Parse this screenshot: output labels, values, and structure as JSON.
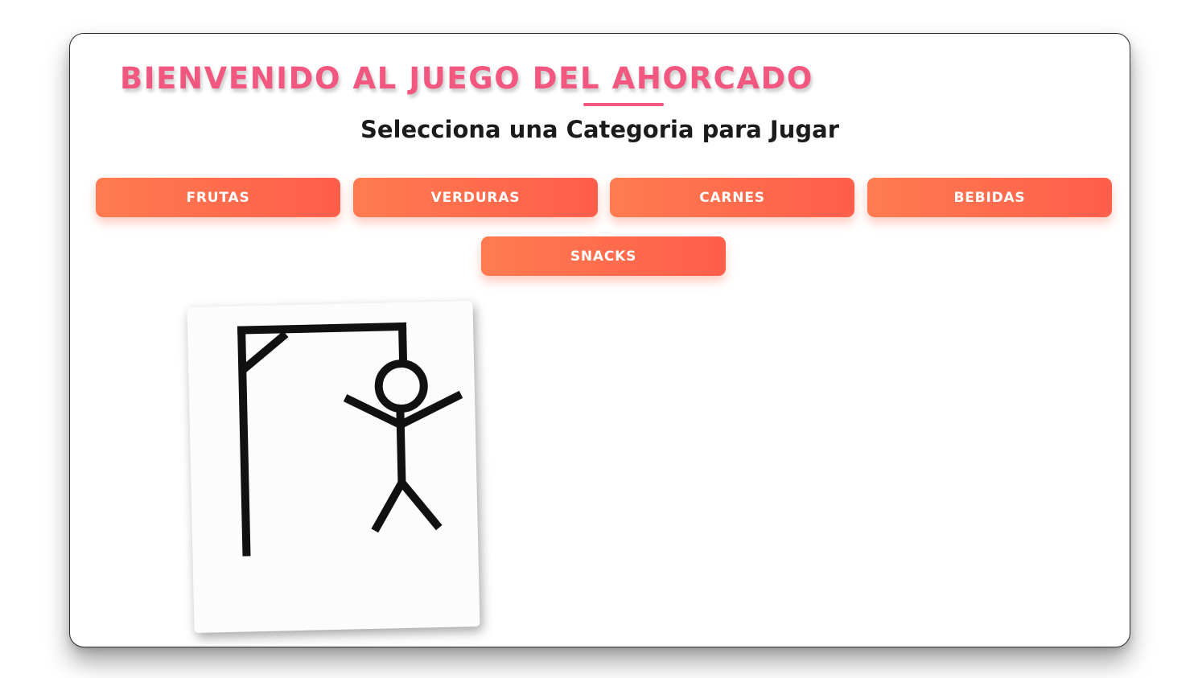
{
  "header": {
    "title": "BIENVENIDO AL JUEGO DEL AHORCADO",
    "subtitle": "Selecciona una Categoria para Jugar"
  },
  "categories": [
    {
      "label": "FRUTAS"
    },
    {
      "label": "VERDURAS"
    },
    {
      "label": "CARNES"
    },
    {
      "label": "BEBIDAS"
    },
    {
      "label": "SNACKS"
    }
  ],
  "hangman_image": {
    "icon": "hangman-icon"
  },
  "colors": {
    "title": "#f2587f",
    "button_start": "#ff7b4f",
    "button_end": "#ff5e4b",
    "subtitle": "#1b1b1b",
    "drawing": "#111111"
  }
}
